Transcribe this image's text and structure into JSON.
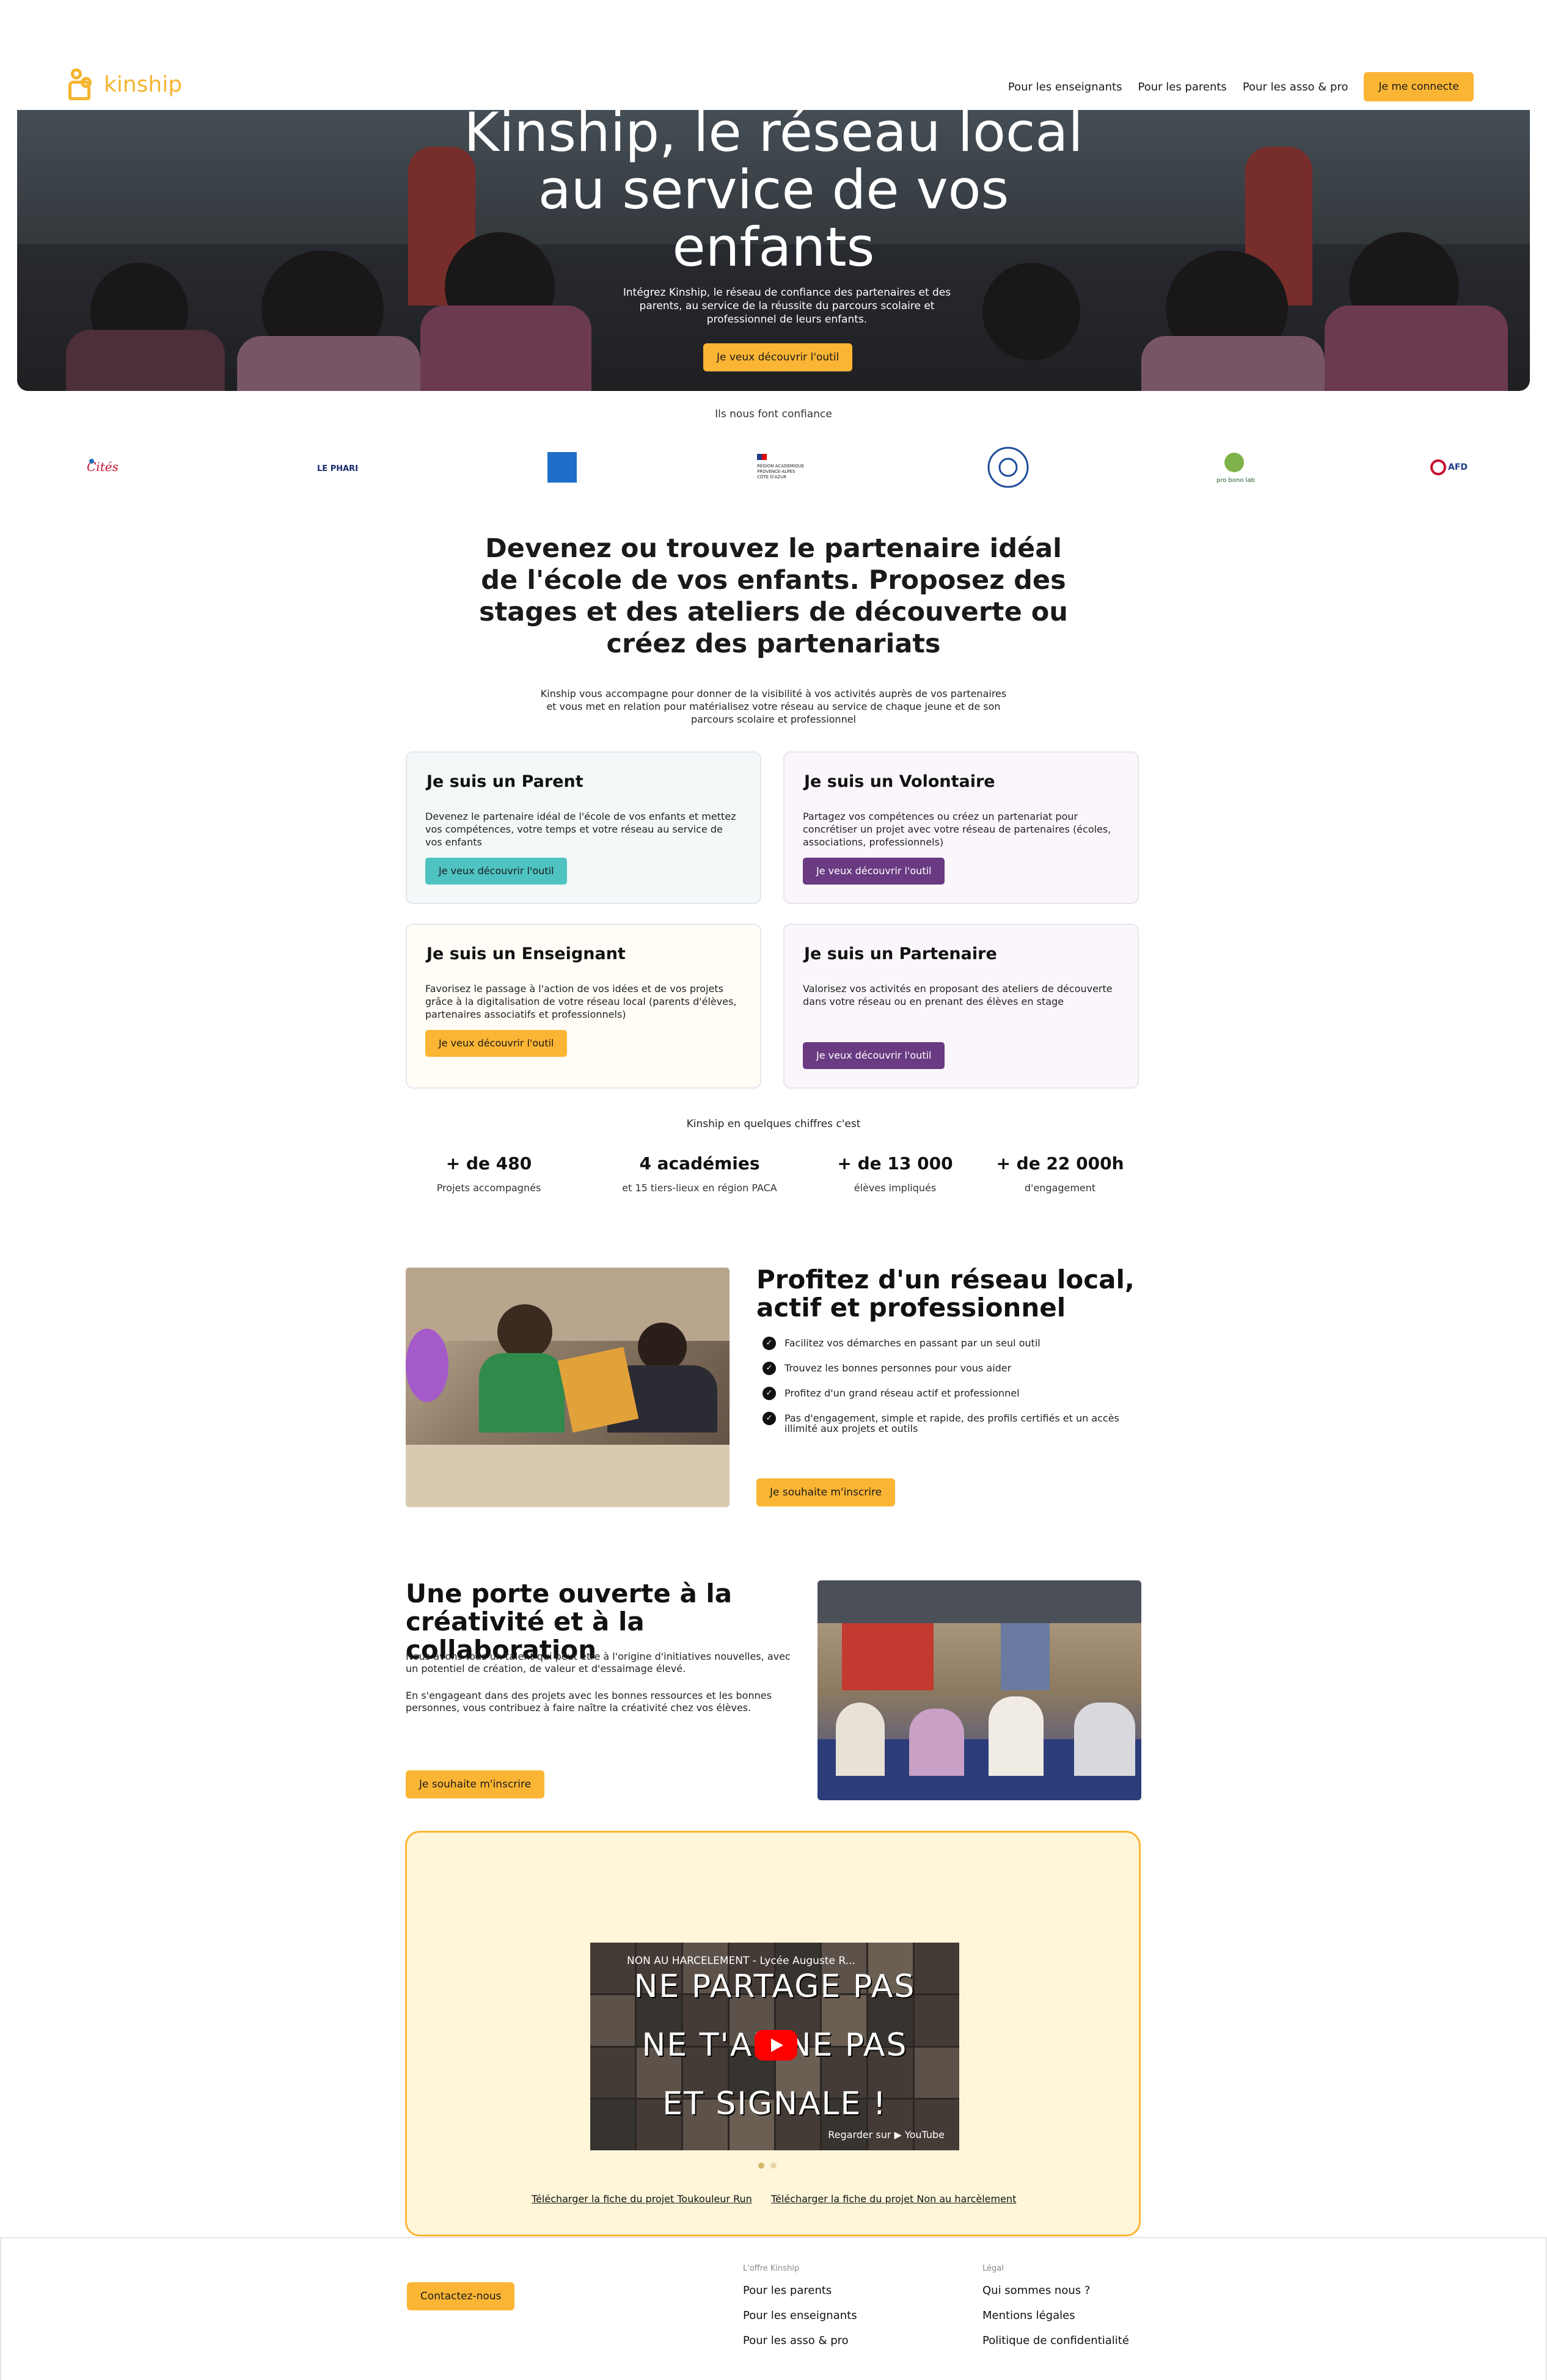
{
  "header": {
    "logo": "kinship",
    "nav": [
      "Pour les enseignants",
      "Pour les parents",
      "Pour les asso & pro"
    ],
    "login": "Je me connecte"
  },
  "hero": {
    "title_lines": [
      "Kinship, le réseau local",
      "au service de vos",
      "enfants"
    ],
    "subtitle": "Intégrez Kinship, le réseau de confiance des partenaires et des parents, au service de la réussite du parcours scolaire et professionnel de leurs enfants.",
    "cta": "Je veux découvrir l'outil"
  },
  "trust": {
    "label": "Ils nous font confiance",
    "logos": [
      "Cités éducatives",
      "LE PHARE",
      "Fondation de France",
      "RÉGION ACADÉMIQUE PROVENCE-ALPES CÔTE D'AZUR",
      "UNAPEI",
      "pro bono lab",
      "AFD"
    ]
  },
  "intro": {
    "title": "Devenez ou trouvez le partenaire idéal de l'école de vos enfants. Proposez des stages et des ateliers de découverte ou créez des partenariats",
    "subtitle": "Kinship vous accompagne pour donner de la visibilité à vos activités auprès de vos partenaires et vous met en relation pour matérialisez votre réseau au service de chaque jeune et de son parcours scolaire et professionnel"
  },
  "cards": [
    {
      "title": "Je suis un Parent",
      "text": "Devenez le partenaire idéal de l'école de vos enfants et mettez vos compétences, votre temps et votre réseau au service de vos enfants",
      "cta": "Je veux découvrir l'outil",
      "accent": "#4fc3c2",
      "bg": "#f3f9f9"
    },
    {
      "title": "Je suis un Volontaire",
      "text": "Partagez vos compétences ou créez un partenariat pour concrétiser un projet avec votre réseau de partenaires (écoles, associations, professionnels)",
      "cta": "Je veux découvrir l'outil",
      "accent": "#6a3a82",
      "bg": "#faf6fb"
    },
    {
      "title": "Je suis un Enseignant",
      "text": "Favorisez le passage à l'action de vos idées et de vos projets grâce à la digitalisation de votre réseau local (parents d'élèves, partenaires associatifs et professionnels)",
      "cta": "Je veux découvrir l'outil",
      "accent": "#fbb534",
      "bg": "#fffdf7"
    },
    {
      "title": "Je suis un Partenaire",
      "text": "Valorisez vos activités en proposant des ateliers de découverte dans votre réseau ou en prenant des élèves en stage",
      "cta": "Je veux découvrir l'outil",
      "accent": "#6a3a82",
      "bg": "#faf6fb"
    }
  ],
  "stats": {
    "label": "Kinship en quelques chiffres c'est",
    "items": [
      {
        "value": "+ de 480",
        "label": "Projets accompagnés"
      },
      {
        "value": "4 académies",
        "label": "et 15 tiers-lieux en région PACA"
      },
      {
        "value": "+ de 13 000",
        "label": "élèves impliqués"
      },
      {
        "value": "+ de 22 000h",
        "label": "d'engagement"
      }
    ]
  },
  "network": {
    "title": "Profitez d'un réseau local, actif et professionnel",
    "items": [
      "Facilitez vos démarches en passant par un seul outil",
      "Trouvez les bonnes personnes pour vous aider",
      "Profitez d'un grand réseau actif et professionnel",
      "Pas d'engagement, simple et rapide, des profils certifiés et un accès illimité aux projets et outils"
    ],
    "cta": "Je souhaite m'inscrire"
  },
  "creativity": {
    "title": "Une porte ouverte à la créativité et à la collaboration",
    "p1": "Nous avons tous un talent qui peut être à l'origine d'initiatives nouvelles, avec un potentiel de création, de valeur et d'essaimage élevé.",
    "p2": "En s'engageant dans des projets avec les bonnes ressources et les bonnes personnes, vous contribuez à faire naître la créativité chez vos élèves.",
    "cta": "Je souhaite m'inscrire"
  },
  "video": {
    "heading": "NON AU HARCELEMENT - Lycée Auguste R...",
    "lines": [
      "NE PARTAGE PAS",
      "NE T'AB   NE PAS",
      "ET SIGNALE !"
    ],
    "watch": "Regarder sur ▶ YouTube",
    "link1": "Télécharger la fiche du projet Toukouleur Run",
    "link2": "Télécharger la fiche du projet Non au harcèlement"
  },
  "footer": {
    "contact": "Contactez-nous",
    "col1_title": "L'offre Kinship",
    "col1": [
      "Pour les parents",
      "Pour les enseignants",
      "Pour les asso & pro"
    ],
    "col2_title": "Légal",
    "col2": [
      "Qui sommes nous ?",
      "Mentions légales",
      "Politique de confidentialité"
    ]
  }
}
